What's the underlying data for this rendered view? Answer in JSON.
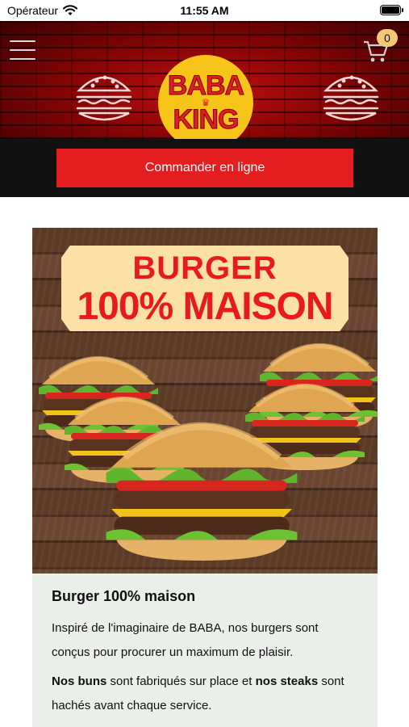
{
  "status_bar": {
    "carrier": "Opérateur",
    "time": "11:55 AM"
  },
  "header": {
    "logo_line1": "BABA",
    "logo_line2": "KING",
    "cart_count": "0"
  },
  "cta": {
    "label": "Commander en ligne"
  },
  "promo": {
    "line1": "BURGER",
    "line2": "100% MAISON"
  },
  "card": {
    "title": "Burger 100% maison",
    "paragraph1": "Inspiré de l'imaginaire de BABA, nos burgers sont conçus pour procurer un maximum de plaisir.",
    "p2_bold1": "Nos buns",
    "p2_text1": " sont fabriqués sur place et ",
    "p2_bold2": "nos steaks",
    "p2_text2": " sont hachés avant chaque service."
  },
  "icons": [
    "wifi-icon",
    "battery-icon",
    "menu-icon",
    "cart-icon",
    "burger-neon-icon"
  ],
  "colors": {
    "accent_red": "#e41e1e",
    "logo_yellow": "#f7c51a",
    "badge": "#f3c978",
    "card_bg": "#eaefe9"
  }
}
